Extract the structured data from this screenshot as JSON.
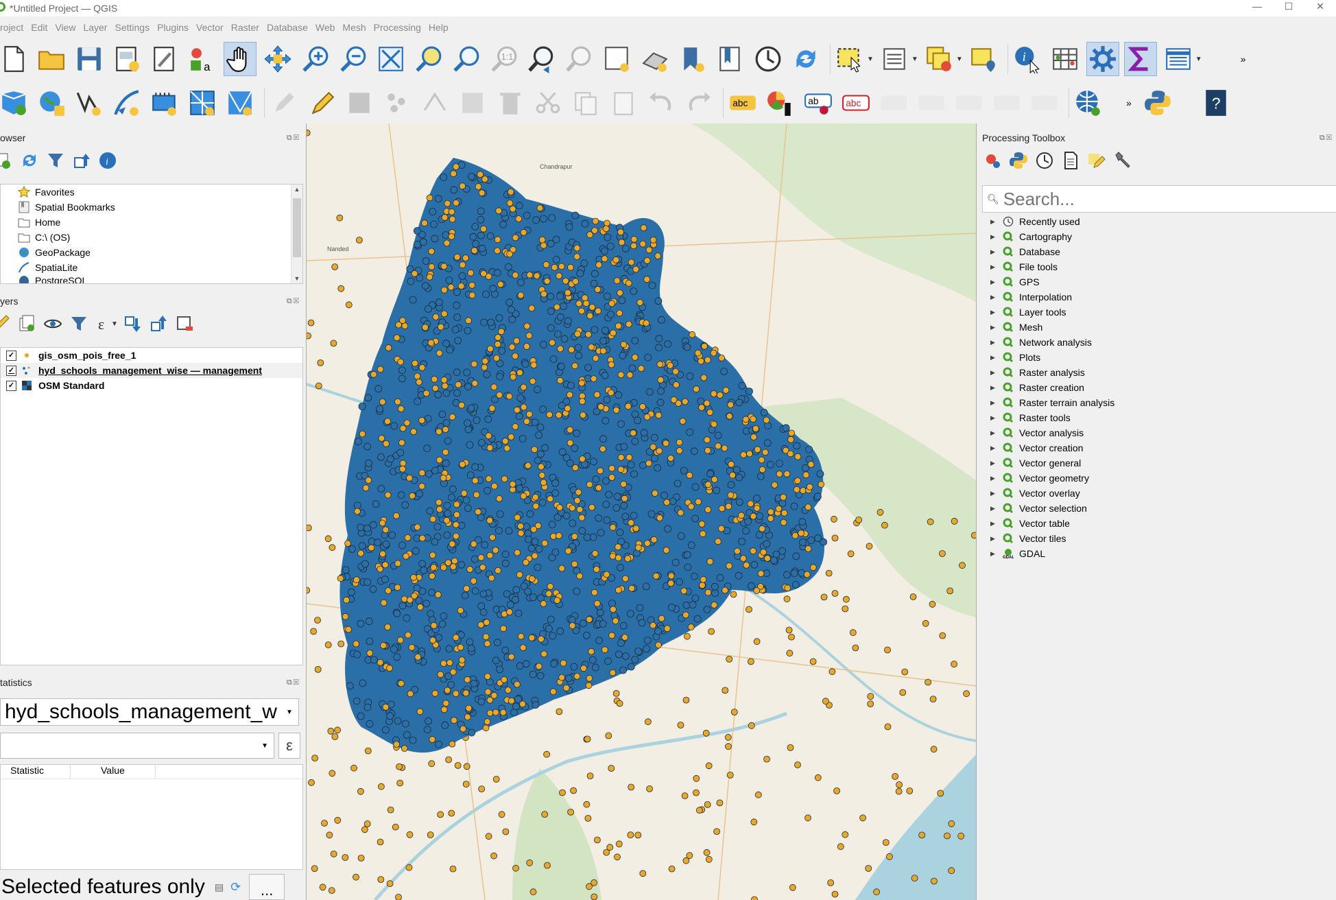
{
  "window": {
    "title": "*Untitled Project — QGIS",
    "controls": [
      "—",
      "☐",
      "✕"
    ]
  },
  "menu": [
    "Project",
    "Edit",
    "View",
    "Layer",
    "Settings",
    "Plugins",
    "Vector",
    "Raster",
    "Database",
    "Web",
    "Mesh",
    "Processing",
    "Help"
  ],
  "menu_display": [
    "roject",
    "Edit",
    "View",
    "Layer",
    "Settings",
    "Plugins",
    "Vector",
    "Raster",
    "Database",
    "Web",
    "Mesh",
    "Processing",
    "Help"
  ],
  "browser": {
    "title": "owser",
    "items": [
      {
        "label": "Favorites",
        "icon": "star-icon"
      },
      {
        "label": "Spatial Bookmarks",
        "icon": "bookmark-icon"
      },
      {
        "label": "Home",
        "icon": "folder-icon"
      },
      {
        "label": "C:\\ (OS)",
        "icon": "drive-icon"
      },
      {
        "label": "GeoPackage",
        "icon": "geopackage-icon"
      },
      {
        "label": "SpatiaLite",
        "icon": "spatialite-icon"
      },
      {
        "label": "PostgreSQL",
        "icon": "postgres-icon"
      }
    ]
  },
  "layers": {
    "title": "yers",
    "items": [
      {
        "label": "gis_osm_pois_free_1",
        "checked": "✓",
        "icon": "point-layer-icon",
        "color": "#e8a423"
      },
      {
        "label": "hyd_schools_management_wise — management",
        "checked": "✓",
        "icon": "categorized-point-layer-icon",
        "color": "#2f74b5"
      },
      {
        "label": "OSM Standard",
        "checked": "✓",
        "icon": "raster-tile-icon",
        "color": "#333333"
      }
    ]
  },
  "statistics": {
    "title": "tatistics",
    "layer_value": "hyd_schools_management_w",
    "field_value": "",
    "expr_button": "ε",
    "columns": [
      "Statistic",
      "Value"
    ],
    "selected_only_label": "Selected features only",
    "more_button": "..."
  },
  "processing": {
    "title": "Processing Toolbox",
    "search_placeholder": "Search...",
    "groups": [
      "Recently used",
      "Cartography",
      "Database",
      "File tools",
      "GPS",
      "Interpolation",
      "Layer tools",
      "Mesh",
      "Network analysis",
      "Plots",
      "Raster analysis",
      "Raster creation",
      "Raster terrain analysis",
      "Raster tools",
      "Vector analysis",
      "Vector creation",
      "Vector general",
      "Vector geometry",
      "Vector overlay",
      "Vector selection",
      "Vector table",
      "Vector tiles",
      "GDAL"
    ]
  },
  "map_labels": {
    "nanded": "Nanded",
    "chandrapur": "Chandrapur"
  },
  "colors": {
    "blue_points": "#2b6fa8",
    "orange_points": "#e9a829",
    "qgis_green": "#4aa02c",
    "water": "#aad3df",
    "forest": "#cfe4c0"
  }
}
